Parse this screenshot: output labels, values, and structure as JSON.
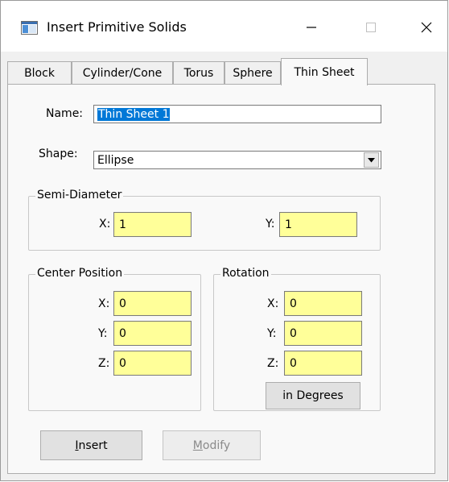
{
  "window": {
    "title": "Insert Primitive Solids",
    "minimize_glyph": "—",
    "maximize_glyph": "☐",
    "close_glyph": "✕"
  },
  "tabs": [
    {
      "label": "Block"
    },
    {
      "label": "Cylinder/Cone"
    },
    {
      "label": "Torus"
    },
    {
      "label": "Sphere"
    },
    {
      "label": "Thin Sheet",
      "active": true
    }
  ],
  "form": {
    "name_label": "Name:",
    "name_value": "Thin Sheet 1",
    "shape_label": "Shape:",
    "shape_value": "Ellipse"
  },
  "semi_diameter": {
    "title": "Semi-Diameter",
    "x_label": "X:",
    "x_value": "1",
    "y_label": "Y:",
    "y_value": "1"
  },
  "center_position": {
    "title": "Center Position",
    "x_label": "X:",
    "x_value": "0",
    "y_label": "Y:",
    "y_value": "0",
    "z_label": "Z:",
    "z_value": "0"
  },
  "rotation": {
    "title": "Rotation",
    "x_label": "X:",
    "x_value": "0",
    "y_label": "Y:",
    "y_value": "0",
    "z_label": "Z:",
    "z_value": "0",
    "units_button": "in Degrees"
  },
  "buttons": {
    "insert_rest": "nsert",
    "insert_mnemonic": "I",
    "modify_rest": "odify",
    "modify_mnemonic": "M"
  },
  "colors": {
    "field_highlight": "#ffff99",
    "selection": "#0078d7"
  }
}
